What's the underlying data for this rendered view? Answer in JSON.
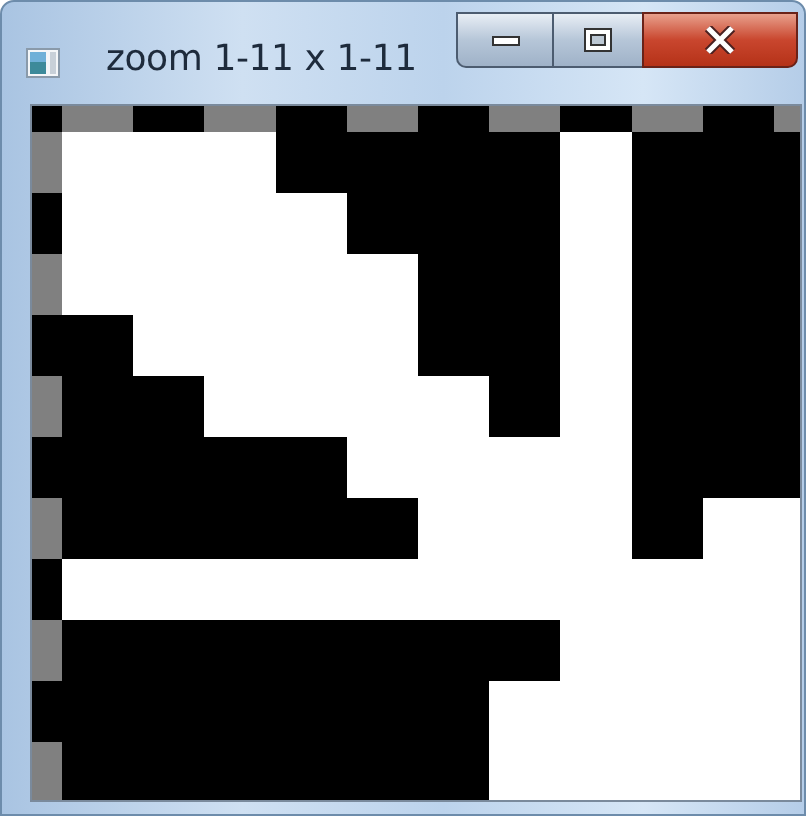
{
  "window": {
    "title": "zoom 1-11 x 1-11"
  }
}
